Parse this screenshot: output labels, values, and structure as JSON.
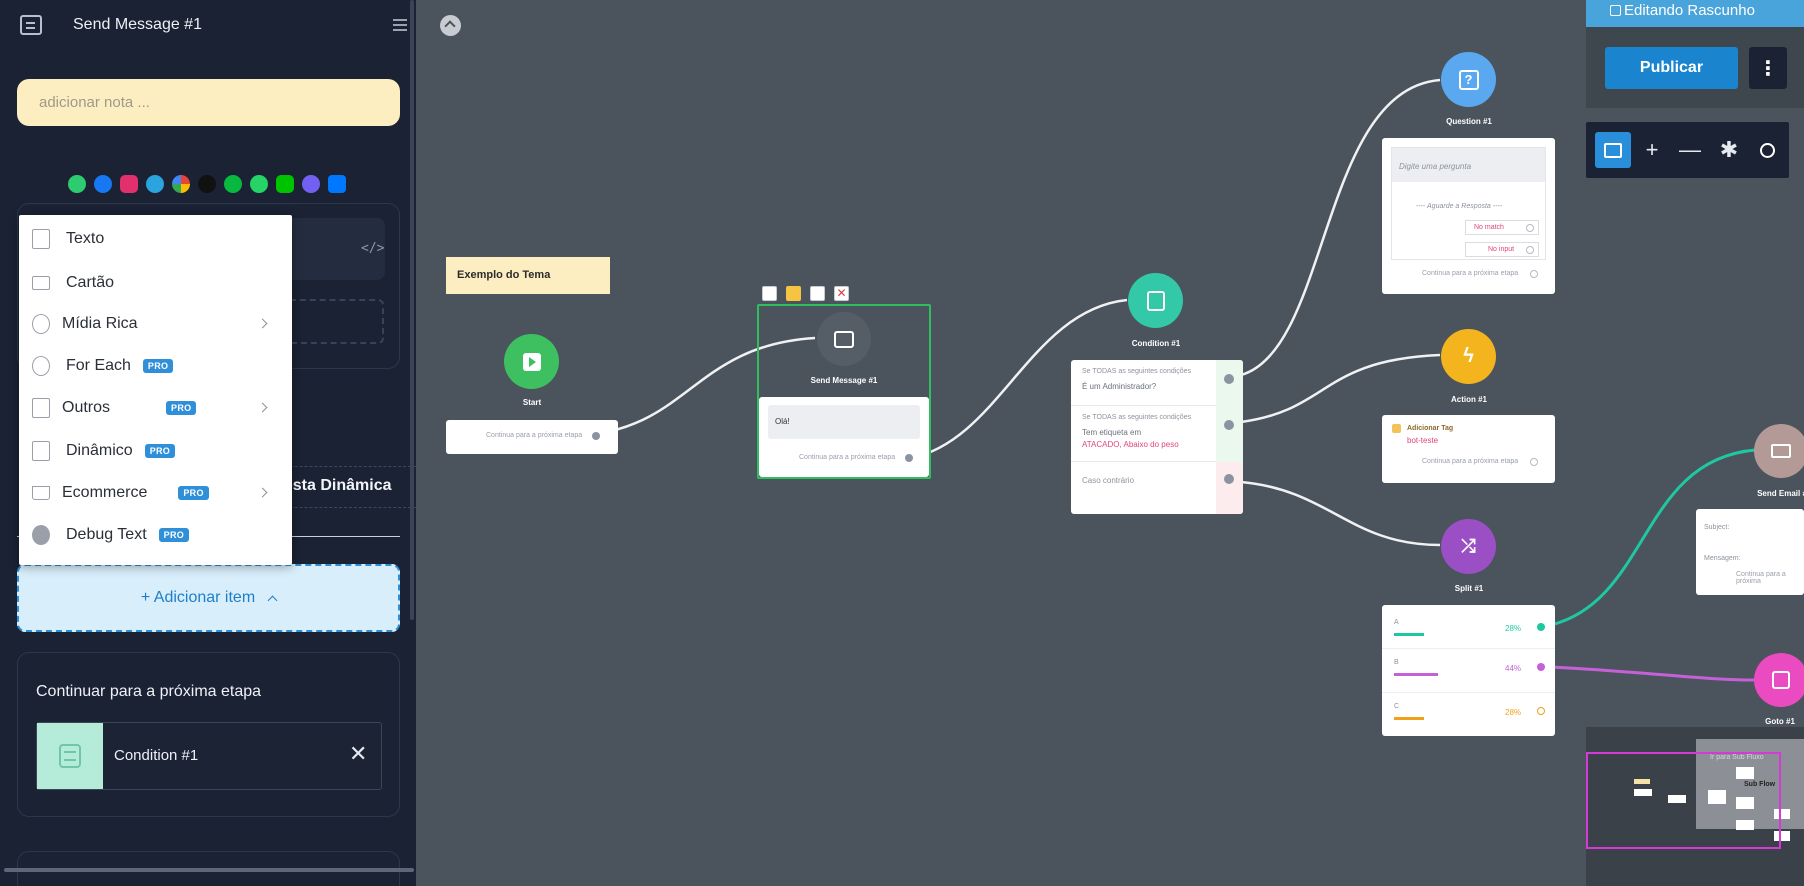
{
  "sidebar": {
    "title": "Send Message #1",
    "note_placeholder": "adicionar nota ...",
    "channels": [
      {
        "name": "livechat-icon",
        "color": "#2ecc71"
      },
      {
        "name": "messenger-icon",
        "color": "#1877f2"
      },
      {
        "name": "instagram-icon",
        "color": "#e1306c"
      },
      {
        "name": "telegram-icon",
        "color": "#2aa3df"
      },
      {
        "name": "google-icon",
        "color": "#ea4335"
      },
      {
        "name": "tiktok-icon",
        "color": "#111111"
      },
      {
        "name": "wechat-icon",
        "color": "#09b83e"
      },
      {
        "name": "whatsapp-icon",
        "color": "#25d366"
      },
      {
        "name": "line-icon",
        "color": "#00c300"
      },
      {
        "name": "viber-icon",
        "color": "#7360f2"
      },
      {
        "name": "vk-icon",
        "color": "#0077ff"
      }
    ],
    "dynamic_label": "osta Dinâmica",
    "add_item_label": "+ Adicionar item",
    "next_step": {
      "title": "Continuar para a próxima etapa",
      "target": "Condition #1"
    }
  },
  "dropdown": {
    "items": [
      {
        "label": "Texto",
        "pro": false,
        "submenu": false
      },
      {
        "label": "Cartão",
        "pro": false,
        "submenu": false
      },
      {
        "label": "Mídia Rica",
        "pro": false,
        "submenu": true
      },
      {
        "label": "For Each",
        "pro": true,
        "submenu": false
      },
      {
        "label": "Outros",
        "pro": true,
        "submenu": true
      },
      {
        "label": "Dinâmico",
        "pro": true,
        "submenu": false
      },
      {
        "label": "Ecommerce",
        "pro": true,
        "submenu": true
      },
      {
        "label": "Debug Text",
        "pro": true,
        "submenu": false
      }
    ],
    "pro_badge": "PRO"
  },
  "canvas": {
    "sticky_note": "Exemplo do Tema",
    "continue_text": "Continua para a próxima etapa",
    "nodes": {
      "start": {
        "label": "Start"
      },
      "send_message": {
        "label": "Send Message #1",
        "message": "Olá!"
      },
      "condition": {
        "label": "Condition #1",
        "rows": [
          {
            "heading": "Se TODAS as seguintes condições",
            "body": "É um Administrador?",
            "highlight": ""
          },
          {
            "heading": "Se TODAS as seguintes condições",
            "body": "Tem etiqueta em",
            "highlight": "ATACADO, Abaixo do peso"
          },
          {
            "heading": "",
            "body": "Caso contrário",
            "highlight": ""
          }
        ]
      },
      "question": {
        "label": "Question #1",
        "prompt": "Digite uma pergunta",
        "await": "---- Aguarde a Resposta ----",
        "no_match": "No match",
        "no_input": "No input"
      },
      "action": {
        "label": "Action #1",
        "tag_title": "Adicionar Tag",
        "tag_value": "bot-teste"
      },
      "split": {
        "label": "Split #1",
        "rows": [
          {
            "name": "A",
            "percent": "28%",
            "color": "#1fc8a2"
          },
          {
            "name": "B",
            "percent": "44%",
            "color": "#c561d8"
          },
          {
            "name": "C",
            "percent": "28%",
            "color": "#f0a019"
          }
        ]
      },
      "send_email": {
        "label": "Send Email #",
        "subject": "Subject:",
        "message": "Mensagem:",
        "continue": "Continua para a próxima"
      },
      "goto": {
        "label": "Goto #1"
      }
    }
  },
  "right_panel": {
    "editing": "Editando Rascunho",
    "publish": "Publicar",
    "tools": [
      "add-folder-icon",
      "zoom-in-icon",
      "zoom-out-icon",
      "layout-icon",
      "search-icon"
    ]
  },
  "minimap": {
    "labels": [
      "Ir para Sub Fluxo",
      "Sub Flow"
    ]
  }
}
